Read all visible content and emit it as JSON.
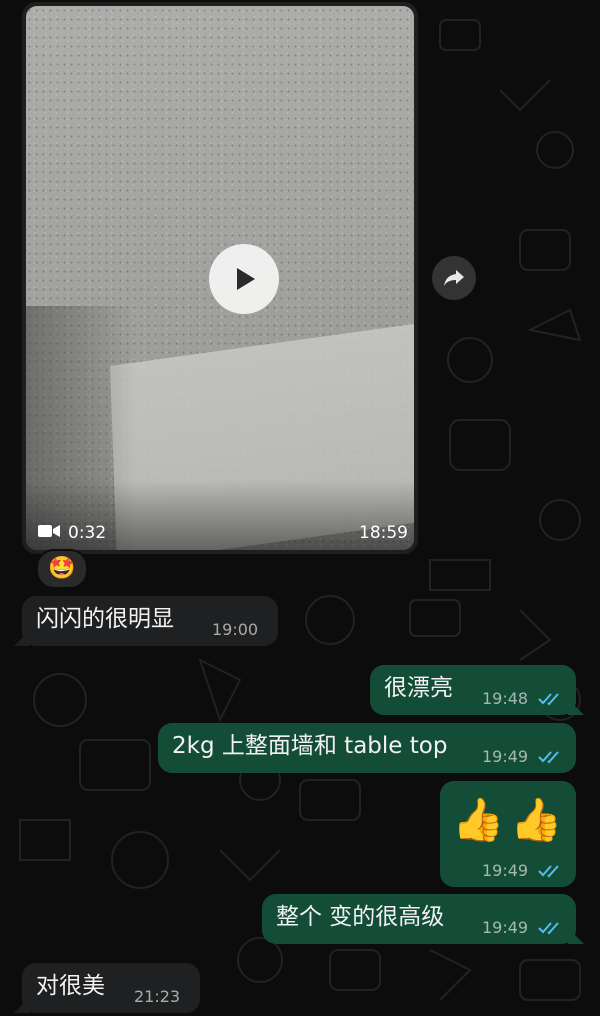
{
  "video_message": {
    "duration": "0:32",
    "time": "18:59",
    "reaction": "🤩",
    "icons": {
      "camera": "video-camera-icon",
      "play": "play-icon",
      "forward": "forward-arrow-icon"
    }
  },
  "messages": [
    {
      "direction": "incoming",
      "text": "闪闪的很明显",
      "time": "19:00"
    },
    {
      "direction": "outgoing",
      "text": "很漂亮",
      "time": "19:48",
      "status": "read"
    },
    {
      "direction": "outgoing",
      "text": "2kg 上整面墙和 table top",
      "time": "19:49",
      "status": "read"
    },
    {
      "direction": "outgoing",
      "text": "👍👍",
      "time": "19:49",
      "status": "read"
    },
    {
      "direction": "outgoing",
      "text": "整个 变的很高级",
      "time": "19:49",
      "status": "read"
    },
    {
      "direction": "incoming",
      "text": "对很美",
      "time": "21:23"
    }
  ],
  "colors": {
    "background": "#0c0c0c",
    "incoming_bubble": "#1f2021",
    "outgoing_bubble": "#144d37",
    "read_ticks": "#53bdeb"
  }
}
